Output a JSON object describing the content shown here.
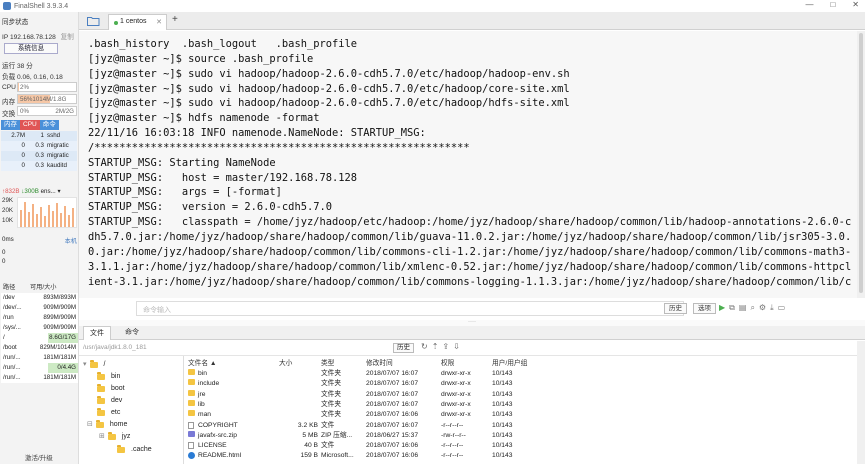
{
  "window": {
    "title": "FinalShell 3.9.3.4",
    "controls": [
      "—",
      "□",
      "✕"
    ]
  },
  "sidebar": {
    "sync_status": "同步状态",
    "ip": "IP 192.168.78.128",
    "copy": "复制",
    "sysinfo_button": "系统信息",
    "uptime": "运行 38 分",
    "load": "负载 0.06, 0.16, 0.18",
    "cpu": {
      "label": "CPU",
      "value": "2%",
      "fill": 0.02
    },
    "mem": {
      "label": "内存",
      "value": "56%1014M/1.8G",
      "fill": 0.56
    },
    "swap": {
      "label": "交换",
      "value": "0%",
      "total": "2M/2G",
      "fill": 0.0
    },
    "proc_tabs": {
      "mem": "内存",
      "cpu": "CPU",
      "cmd": "命令"
    },
    "processes": [
      {
        "mem": "2.7M",
        "cpu": "1",
        "cmd": "sshd"
      },
      {
        "mem": "0",
        "cpu": "0.3",
        "cmd": "migratic"
      },
      {
        "mem": "0",
        "cpu": "0.3",
        "cmd": "migratic"
      },
      {
        "mem": "0",
        "cpu": "0.3",
        "cmd": "kauditd"
      }
    ],
    "net": {
      "up": "↑832B",
      "down": "↓300B",
      "iface": "ens...",
      "y_ticks": [
        "29K",
        "20K",
        "10K"
      ]
    },
    "latency": {
      "label": "0ms",
      "local": "本机",
      "rows": [
        "0",
        "0"
      ]
    },
    "disk_header": {
      "path": "路径",
      "usage": "可用/大小"
    },
    "disks": [
      {
        "path": "/dev",
        "usage": "893M/893M",
        "hl": false
      },
      {
        "path": "/dev/...",
        "usage": "909M/909M",
        "hl": false
      },
      {
        "path": "/run",
        "usage": "899M/909M",
        "hl": false
      },
      {
        "path": "/sys/...",
        "usage": "909M/909M",
        "hl": false
      },
      {
        "path": "/",
        "usage": "8.6G/17G",
        "hl": true
      },
      {
        "path": "/boot",
        "usage": "829M/1014M",
        "hl": false
      },
      {
        "path": "/run/...",
        "usage": "181M/181M",
        "hl": false
      },
      {
        "path": "/run/...",
        "usage": "0/4.4G",
        "hl": true
      },
      {
        "path": "/run/...",
        "usage": "181M/181M",
        "hl": false
      }
    ],
    "activate": "激活/升级"
  },
  "tabs": {
    "session": "1 centos",
    "close": "✕",
    "add": "+"
  },
  "terminal": {
    "lines": [
      ".bash_history  .bash_logout   .bash_profile",
      "[jyz@master ~]$ source .bash_profile",
      "[jyz@master ~]$ sudo vi hadoop/hadoop-2.6.0-cdh5.7.0/etc/hadoop/hadoop-env.sh",
      "[jyz@master ~]$ sudo vi hadoop/hadoop-2.6.0-cdh5.7.0/etc/hadoop/core-site.xml",
      "[jyz@master ~]$ sudo vi hadoop/hadoop-2.6.0-cdh5.7.0/etc/hadoop/hdfs-site.xml",
      "[jyz@master ~]$ hdfs namenode -format",
      "22/11/16 16:03:18 INFO namenode.NameNode: STARTUP_MSG:",
      "/************************************************************",
      "STARTUP_MSG: Starting NameNode",
      "STARTUP_MSG:   host = master/192.168.78.128",
      "STARTUP_MSG:   args = [-format]",
      "STARTUP_MSG:   version = 2.6.0-cdh5.7.0",
      "STARTUP_MSG:   classpath = /home/jyz/hadoop/etc/hadoop:/home/jyz/hadoop/share/hadoop/common/lib/hadoop-annotations-2.6.0-c",
      "dh5.7.0.jar:/home/jyz/hadoop/share/hadoop/common/lib/guava-11.0.2.jar:/home/jyz/hadoop/share/hadoop/common/lib/jsr305-3.0.",
      "0.jar:/home/jyz/hadoop/share/hadoop/common/lib/commons-cli-1.2.jar:/home/jyz/hadoop/share/hadoop/common/lib/commons-math3-",
      "3.1.1.jar:/home/jyz/hadoop/share/hadoop/common/lib/xmlenc-0.52.jar:/home/jyz/hadoop/share/hadoop/common/lib/commons-httpcl",
      "ient-3.1.jar:/home/jyz/hadoop/share/hadoop/common/lib/commons-logging-1.1.3.jar:/home/jyz/hadoop/share/hadoop/common/lib/c"
    ]
  },
  "command_bar": {
    "placeholder": "命令输入",
    "history": "历史",
    "options": "选项"
  },
  "file_tabs": {
    "files": "文件",
    "commands": "命令"
  },
  "path_bar": {
    "path": "/usr/java/jdk1.8.0_181",
    "history": "历史"
  },
  "tree": {
    "root": "/",
    "items": [
      "bin",
      "boot",
      "dev",
      "etc",
      "home",
      "jyz",
      ".cache"
    ]
  },
  "file_list": {
    "columns": [
      "文件名 ▲",
      "大小",
      "类型",
      "修改时间",
      "权限",
      "用户/用户组"
    ],
    "rows": [
      {
        "name": "bin",
        "size": "",
        "type": "文件夹",
        "mtime": "2018/07/07 16:07",
        "perm": "drwxr-xr-x",
        "owner": "10/143",
        "icon": "folder"
      },
      {
        "name": "include",
        "size": "",
        "type": "文件夹",
        "mtime": "2018/07/07 16:07",
        "perm": "drwxr-xr-x",
        "owner": "10/143",
        "icon": "folder"
      },
      {
        "name": "jre",
        "size": "",
        "type": "文件夹",
        "mtime": "2018/07/07 16:07",
        "perm": "drwxr-xr-x",
        "owner": "10/143",
        "icon": "folder"
      },
      {
        "name": "lib",
        "size": "",
        "type": "文件夹",
        "mtime": "2018/07/07 16:07",
        "perm": "drwxr-xr-x",
        "owner": "10/143",
        "icon": "folder"
      },
      {
        "name": "man",
        "size": "",
        "type": "文件夹",
        "mtime": "2018/07/07 16:06",
        "perm": "drwxr-xr-x",
        "owner": "10/143",
        "icon": "folder"
      },
      {
        "name": "COPYRIGHT",
        "size": "3.2 KB",
        "type": "文件",
        "mtime": "2018/07/07 16:07",
        "perm": "-r--r--r--",
        "owner": "10/143",
        "icon": "doc"
      },
      {
        "name": "javafx-src.zip",
        "size": "5 MB",
        "type": "ZIP 压缩...",
        "mtime": "2018/06/27 15:37",
        "perm": "-rw-r--r--",
        "owner": "10/143",
        "icon": "zip"
      },
      {
        "name": "LICENSE",
        "size": "40 B",
        "type": "文件",
        "mtime": "2018/07/07 16:06",
        "perm": "-r--r--r--",
        "owner": "10/143",
        "icon": "doc"
      },
      {
        "name": "README.html",
        "size": "159 B",
        "type": "Microsoft...",
        "mtime": "2018/07/07 16:06",
        "perm": "-r--r--r--",
        "owner": "10/143",
        "icon": "html"
      }
    ]
  },
  "colors": {
    "accent_blue": "#4a90d9",
    "cpu_red": "#e05555",
    "folder_yellow": "#f4c542",
    "session_dot": "#4caf50"
  }
}
